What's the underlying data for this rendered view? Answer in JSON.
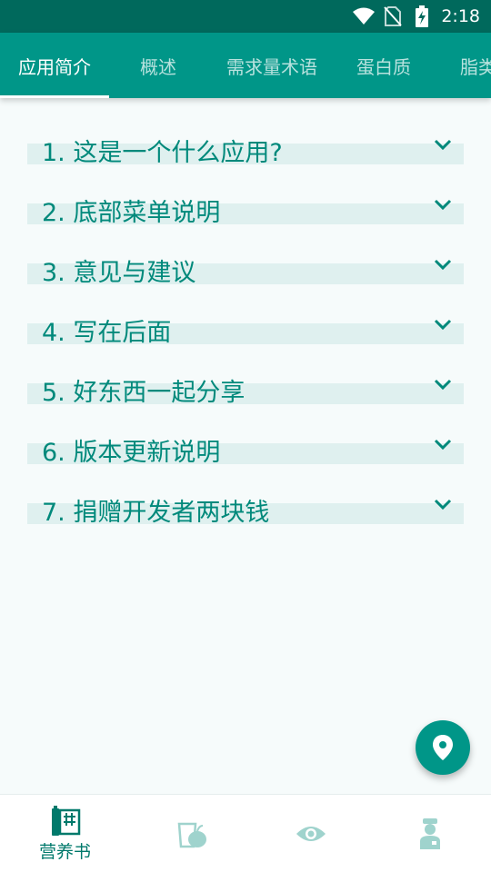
{
  "status_bar": {
    "time": "2:18",
    "icons": [
      "wifi-icon",
      "no-sim-icon",
      "battery-charging-icon"
    ]
  },
  "tabs": [
    {
      "label": "应用简介",
      "active": true
    },
    {
      "label": "概述",
      "active": false
    },
    {
      "label": "需求量术语",
      "active": false
    },
    {
      "label": "蛋白质",
      "active": false
    },
    {
      "label": "脂类",
      "active": false
    }
  ],
  "faq": [
    {
      "label": "1. 这是一个什么应用?"
    },
    {
      "label": "2. 底部菜单说明"
    },
    {
      "label": "3. 意见与建议"
    },
    {
      "label": "4. 写在后面"
    },
    {
      "label": "5. 好东西一起分享"
    },
    {
      "label": "6. 版本更新说明"
    },
    {
      "label": "7. 捐赠开发者两块钱"
    }
  ],
  "fab": {
    "icon": "location-pin-icon"
  },
  "bottom_nav": [
    {
      "label": "营养书",
      "icon": "book-icon",
      "active": true
    },
    {
      "label": "",
      "icon": "fruit-icon",
      "active": false
    },
    {
      "label": "",
      "icon": "eye-icon",
      "active": false
    },
    {
      "label": "",
      "icon": "doctor-icon",
      "active": false
    }
  ],
  "colors": {
    "primary": "#009688",
    "primary_dark": "#00695c",
    "accent_text": "#00897b",
    "band": "#dff0ef"
  }
}
